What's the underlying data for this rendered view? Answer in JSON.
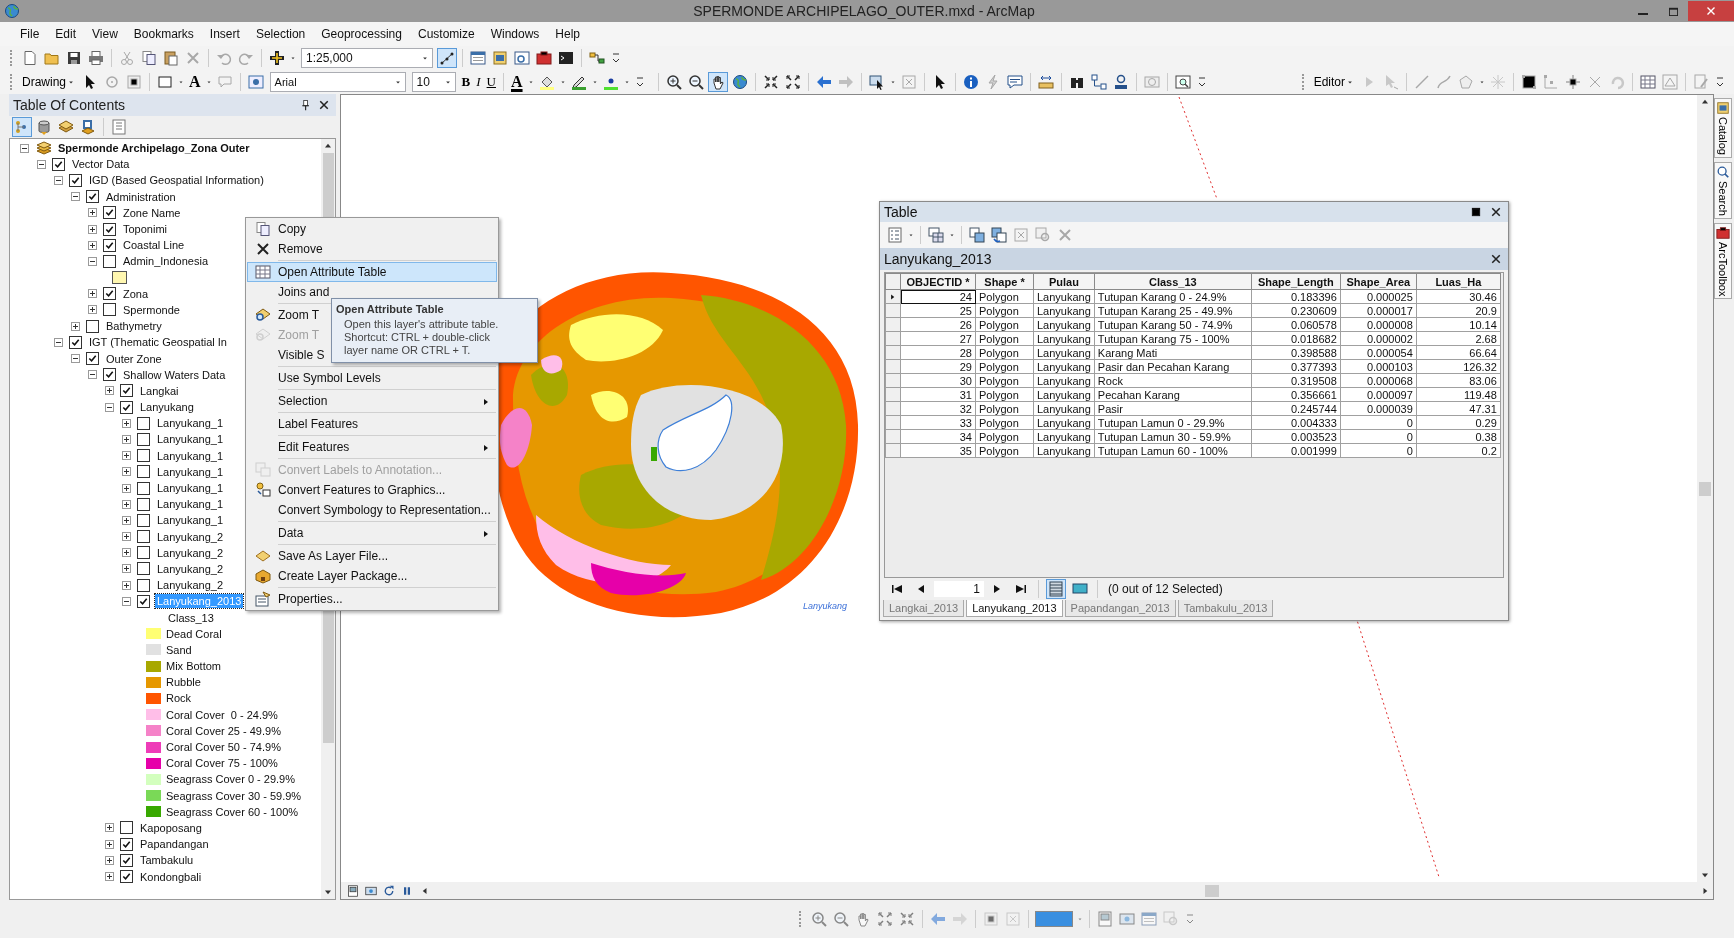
{
  "window": {
    "title": "SPERMONDE ARCHIPELAGO_OUTER.mxd - ArcMap"
  },
  "menu_bar": [
    "File",
    "Edit",
    "View",
    "Bookmarks",
    "Insert",
    "Selection",
    "Geoprocessing",
    "Customize",
    "Windows",
    "Help"
  ],
  "standard_toolbar": {
    "scale": "1:25,000"
  },
  "draw_toolbar": {
    "drawing_menu": "Drawing",
    "text_tool": "A",
    "font": "Arial",
    "font_size": "10",
    "bold": "B",
    "italic": "I",
    "underline": "U",
    "font_color": "A"
  },
  "editor_toolbar": {
    "editor_menu": "Editor"
  },
  "toc": {
    "title": "Table Of Contents",
    "tree": [
      {
        "label": "Spermonde Archipelago_Zona Outer",
        "kind": "frame",
        "expanded": true,
        "children": [
          {
            "label": "Vector Data",
            "kind": "layer",
            "checked": true,
            "expanded": true,
            "selected": false,
            "children": [
              {
                "label": "IGD (Based Geospatial Information)",
                "kind": "layer",
                "checked": true,
                "expanded": true,
                "selected": false,
                "children": [
                  {
                    "label": "Administration",
                    "kind": "layer",
                    "checked": true,
                    "expanded": true,
                    "selected": false,
                    "children": [
                      {
                        "label": "Zone Name",
                        "kind": "layer",
                        "checked": true,
                        "expanded": false,
                        "selected": false
                      },
                      {
                        "label": "Toponimi",
                        "kind": "layer",
                        "checked": true,
                        "expanded": false,
                        "selected": false
                      },
                      {
                        "label": "Coastal Line",
                        "kind": "layer",
                        "checked": true,
                        "expanded": false,
                        "selected": false
                      },
                      {
                        "label": "Admin_Indonesia",
                        "kind": "layer",
                        "checked": false,
                        "expanded": true,
                        "selected": false,
                        "children": [
                          {
                            "kind": "symbol",
                            "color": "#fff7b0"
                          }
                        ]
                      },
                      {
                        "label": "Zona",
                        "kind": "layer",
                        "checked": true,
                        "expanded": false,
                        "selected": false
                      },
                      {
                        "label": "Spermonde",
                        "kind": "layer",
                        "checked": false,
                        "expanded": false,
                        "selected": false
                      }
                    ]
                  },
                  {
                    "label": "Bathymetry",
                    "kind": "layer",
                    "checked": false,
                    "expanded": false,
                    "selected": false
                  }
                ]
              },
              {
                "label": "IGT (Thematic Geospatial In",
                "kind": "layer",
                "checked": true,
                "expanded": true,
                "selected": false,
                "children": [
                  {
                    "label": "Outer Zone",
                    "kind": "layer",
                    "checked": true,
                    "expanded": true,
                    "selected": false,
                    "children": [
                      {
                        "label": "Shallow Waters Data",
                        "kind": "layer",
                        "checked": true,
                        "expanded": true,
                        "selected": false,
                        "children": [
                          {
                            "label": "Langkai",
                            "kind": "layer",
                            "checked": true,
                            "expanded": false,
                            "selected": false
                          },
                          {
                            "label": "Lanyukang",
                            "kind": "layer",
                            "checked": true,
                            "expanded": true,
                            "selected": false,
                            "children": [
                              {
                                "label": "Lanyukang_1",
                                "kind": "layer",
                                "checked": false,
                                "expanded": false,
                                "selected": false
                              },
                              {
                                "label": "Lanyukang_1",
                                "kind": "layer",
                                "checked": false,
                                "expanded": false,
                                "selected": false
                              },
                              {
                                "label": "Lanyukang_1",
                                "kind": "layer",
                                "checked": false,
                                "expanded": false,
                                "selected": false
                              },
                              {
                                "label": "Lanyukang_1",
                                "kind": "layer",
                                "checked": false,
                                "expanded": false,
                                "selected": false
                              },
                              {
                                "label": "Lanyukang_1",
                                "kind": "layer",
                                "checked": false,
                                "expanded": false,
                                "selected": false
                              },
                              {
                                "label": "Lanyukang_1",
                                "kind": "layer",
                                "checked": false,
                                "expanded": false,
                                "selected": false
                              },
                              {
                                "label": "Lanyukang_1",
                                "kind": "layer",
                                "checked": false,
                                "expanded": false,
                                "selected": false
                              },
                              {
                                "label": "Lanyukang_2",
                                "kind": "layer",
                                "checked": false,
                                "expanded": false,
                                "selected": false
                              },
                              {
                                "label": "Lanyukang_2",
                                "kind": "layer",
                                "checked": false,
                                "expanded": false,
                                "selected": false
                              },
                              {
                                "label": "Lanyukang_2",
                                "kind": "layer",
                                "checked": false,
                                "expanded": false,
                                "selected": false
                              },
                              {
                                "label": "Lanyukang_2",
                                "kind": "layer",
                                "checked": false,
                                "expanded": false,
                                "selected": false
                              },
                              {
                                "label": "Lanyukang_2013",
                                "kind": "layer",
                                "checked": true,
                                "expanded": true,
                                "selected": true,
                                "children": [
                                  {
                                    "kind": "heading",
                                    "label": "Class_13"
                                  },
                                  {
                                    "kind": "symbol",
                                    "label": "Dead Coral",
                                    "color": "#ffff73"
                                  },
                                  {
                                    "kind": "symbol",
                                    "label": "Sand",
                                    "color": "#e1e1e1"
                                  },
                                  {
                                    "kind": "symbol",
                                    "label": "Mix Bottom",
                                    "color": "#a8a800"
                                  },
                                  {
                                    "kind": "symbol",
                                    "label": "Rubble",
                                    "color": "#e69800"
                                  },
                                  {
                                    "kind": "symbol",
                                    "label": "Rock",
                                    "color": "#ff5500"
                                  },
                                  {
                                    "kind": "symbol",
                                    "label": "Coral Cover  0 - 24.9%",
                                    "color": "#ffbee8"
                                  },
                                  {
                                    "kind": "symbol",
                                    "label": "Coral Cover 25 - 49.9%",
                                    "color": "#f582c8"
                                  },
                                  {
                                    "kind": "symbol",
                                    "label": "Coral Cover 50 - 74.9%",
                                    "color": "#ee3cb8"
                                  },
                                  {
                                    "kind": "symbol",
                                    "label": "Coral Cover 75 - 100%",
                                    "color": "#e600a9"
                                  },
                                  {
                                    "kind": "symbol",
                                    "label": "Seagrass Cover 0 - 29.9%",
                                    "color": "#d3ffbe"
                                  },
                                  {
                                    "kind": "symbol",
                                    "label": "Seagrass Cover 30 - 59.9%",
                                    "color": "#7ad957"
                                  },
                                  {
                                    "kind": "symbol",
                                    "label": "Seagrass Cover 60 - 100%",
                                    "color": "#38a800"
                                  }
                                ]
                              }
                            ]
                          },
                          {
                            "label": "Kapoposang",
                            "kind": "layer",
                            "checked": false,
                            "expanded": false,
                            "selected": false
                          },
                          {
                            "label": "Papandangan",
                            "kind": "layer",
                            "checked": true,
                            "expanded": false,
                            "selected": false
                          },
                          {
                            "label": "Tambakulu",
                            "kind": "layer",
                            "checked": true,
                            "expanded": false,
                            "selected": false
                          },
                          {
                            "label": "Kondongbali",
                            "kind": "layer",
                            "checked": true,
                            "expanded": false,
                            "selected": false
                          }
                        ]
                      }
                    ]
                  }
                ]
              }
            ]
          }
        ]
      }
    ]
  },
  "context_menu": {
    "groups": [
      [
        {
          "label": "Copy",
          "disabled": false,
          "submenu": false,
          "selected": false
        },
        {
          "label": "Remove",
          "disabled": false,
          "submenu": false,
          "selected": false
        }
      ],
      [
        {
          "label": "Open Attribute Table",
          "disabled": false,
          "submenu": false,
          "selected": true
        },
        {
          "label": "Joins and",
          "disabled": false,
          "submenu": false,
          "selected": false
        }
      ],
      [
        {
          "label": "Zoom T",
          "disabled": false,
          "submenu": false,
          "selected": false
        },
        {
          "label": "Zoom T",
          "disabled": true,
          "submenu": false,
          "selected": false
        },
        {
          "label": "Visible S",
          "disabled": false,
          "submenu": false,
          "selected": false
        }
      ],
      [
        {
          "label": "Use Symbol Levels",
          "disabled": false,
          "submenu": false,
          "selected": false
        }
      ],
      [
        {
          "label": "Selection",
          "disabled": false,
          "submenu": true,
          "selected": false
        }
      ],
      [
        {
          "label": "Label Features",
          "disabled": false,
          "submenu": false,
          "selected": false
        }
      ],
      [
        {
          "label": "Edit Features",
          "disabled": false,
          "submenu": true,
          "selected": false
        }
      ],
      [
        {
          "label": "Convert Labels to Annotation...",
          "disabled": true,
          "submenu": false,
          "selected": false
        },
        {
          "label": "Convert Features to Graphics...",
          "disabled": false,
          "submenu": false,
          "selected": false
        },
        {
          "label": "Convert Symbology to Representation...",
          "disabled": false,
          "submenu": false,
          "selected": false
        }
      ],
      [
        {
          "label": "Data",
          "disabled": false,
          "submenu": true,
          "selected": false
        }
      ],
      [
        {
          "label": "Save As Layer File...",
          "disabled": false,
          "submenu": false,
          "selected": false
        },
        {
          "label": "Create Layer Package...",
          "disabled": false,
          "submenu": false,
          "selected": false
        }
      ],
      [
        {
          "label": "Properties...",
          "disabled": false,
          "submenu": false,
          "selected": false
        }
      ]
    ]
  },
  "tooltip": {
    "title": "Open Attribute Table",
    "lines": [
      "Open this layer's attribute table.",
      "Shortcut: CTRL + double-click",
      "layer name OR CTRL + T."
    ]
  },
  "map": {
    "label": "Lanyukang"
  },
  "table_window": {
    "title": "Table",
    "layer_title": "Lanyukang_2013",
    "columns": [
      "OBJECTID *",
      "Shape *",
      "Pulau",
      "Class_13",
      "Shape_Length",
      "Shape_Area",
      "Luas_Ha"
    ],
    "rows": [
      {
        "current": true,
        "cells": [
          "24",
          "Polygon",
          "Lanyukang",
          "Tutupan Karang 0 - 24.9%",
          "0.183396",
          "0.000025",
          "30.46"
        ]
      },
      {
        "current": false,
        "cells": [
          "25",
          "Polygon",
          "Lanyukang",
          "Tutupan Karang 25 - 49.9%",
          "0.230609",
          "0.000017",
          "20.9"
        ]
      },
      {
        "current": false,
        "cells": [
          "26",
          "Polygon",
          "Lanyukang",
          "Tutupan Karang 50 - 74.9%",
          "0.060578",
          "0.000008",
          "10.14"
        ]
      },
      {
        "current": false,
        "cells": [
          "27",
          "Polygon",
          "Lanyukang",
          "Tutupan Karang 75 - 100%",
          "0.018682",
          "0.000002",
          "2.68"
        ]
      },
      {
        "current": false,
        "cells": [
          "28",
          "Polygon",
          "Lanyukang",
          "Karang Mati",
          "0.398588",
          "0.000054",
          "66.64"
        ]
      },
      {
        "current": false,
        "cells": [
          "29",
          "Polygon",
          "Lanyukang",
          "Pasir dan Pecahan Karang",
          "0.377393",
          "0.000103",
          "126.32"
        ]
      },
      {
        "current": false,
        "cells": [
          "30",
          "Polygon",
          "Lanyukang",
          "Rock",
          "0.319508",
          "0.000068",
          "83.06"
        ]
      },
      {
        "current": false,
        "cells": [
          "31",
          "Polygon",
          "Lanyukang",
          "Pecahan Karang",
          "0.356661",
          "0.000097",
          "119.48"
        ]
      },
      {
        "current": false,
        "cells": [
          "32",
          "Polygon",
          "Lanyukang",
          "Pasir",
          "0.245744",
          "0.000039",
          "47.31"
        ]
      },
      {
        "current": false,
        "cells": [
          "33",
          "Polygon",
          "Lanyukang",
          "Tutupan Lamun 0 - 29.9%",
          "0.004333",
          "0",
          "0.29"
        ]
      },
      {
        "current": false,
        "cells": [
          "34",
          "Polygon",
          "Lanyukang",
          "Tutupan Lamun 30 - 59.9%",
          "0.003523",
          "0",
          "0.38"
        ]
      },
      {
        "current": false,
        "cells": [
          "35",
          "Polygon",
          "Lanyukang",
          "Tutupan Lamun 60 - 100%",
          "0.001999",
          "0",
          "0.2"
        ]
      }
    ],
    "record": "1",
    "view_buttons": [
      {
        "selected": true
      },
      {
        "selected": false
      }
    ],
    "status": "(0 out of 12 Selected)",
    "tabs": [
      {
        "label": "Langkai_2013",
        "selected": false
      },
      {
        "label": "Lanyukang_2013",
        "selected": true
      },
      {
        "label": "Papandangan_2013",
        "selected": false
      },
      {
        "label": "Tambakulu_2013",
        "selected": false
      }
    ]
  },
  "dock_tabs": [
    "Catalog",
    "Search",
    "ArcToolbox"
  ]
}
